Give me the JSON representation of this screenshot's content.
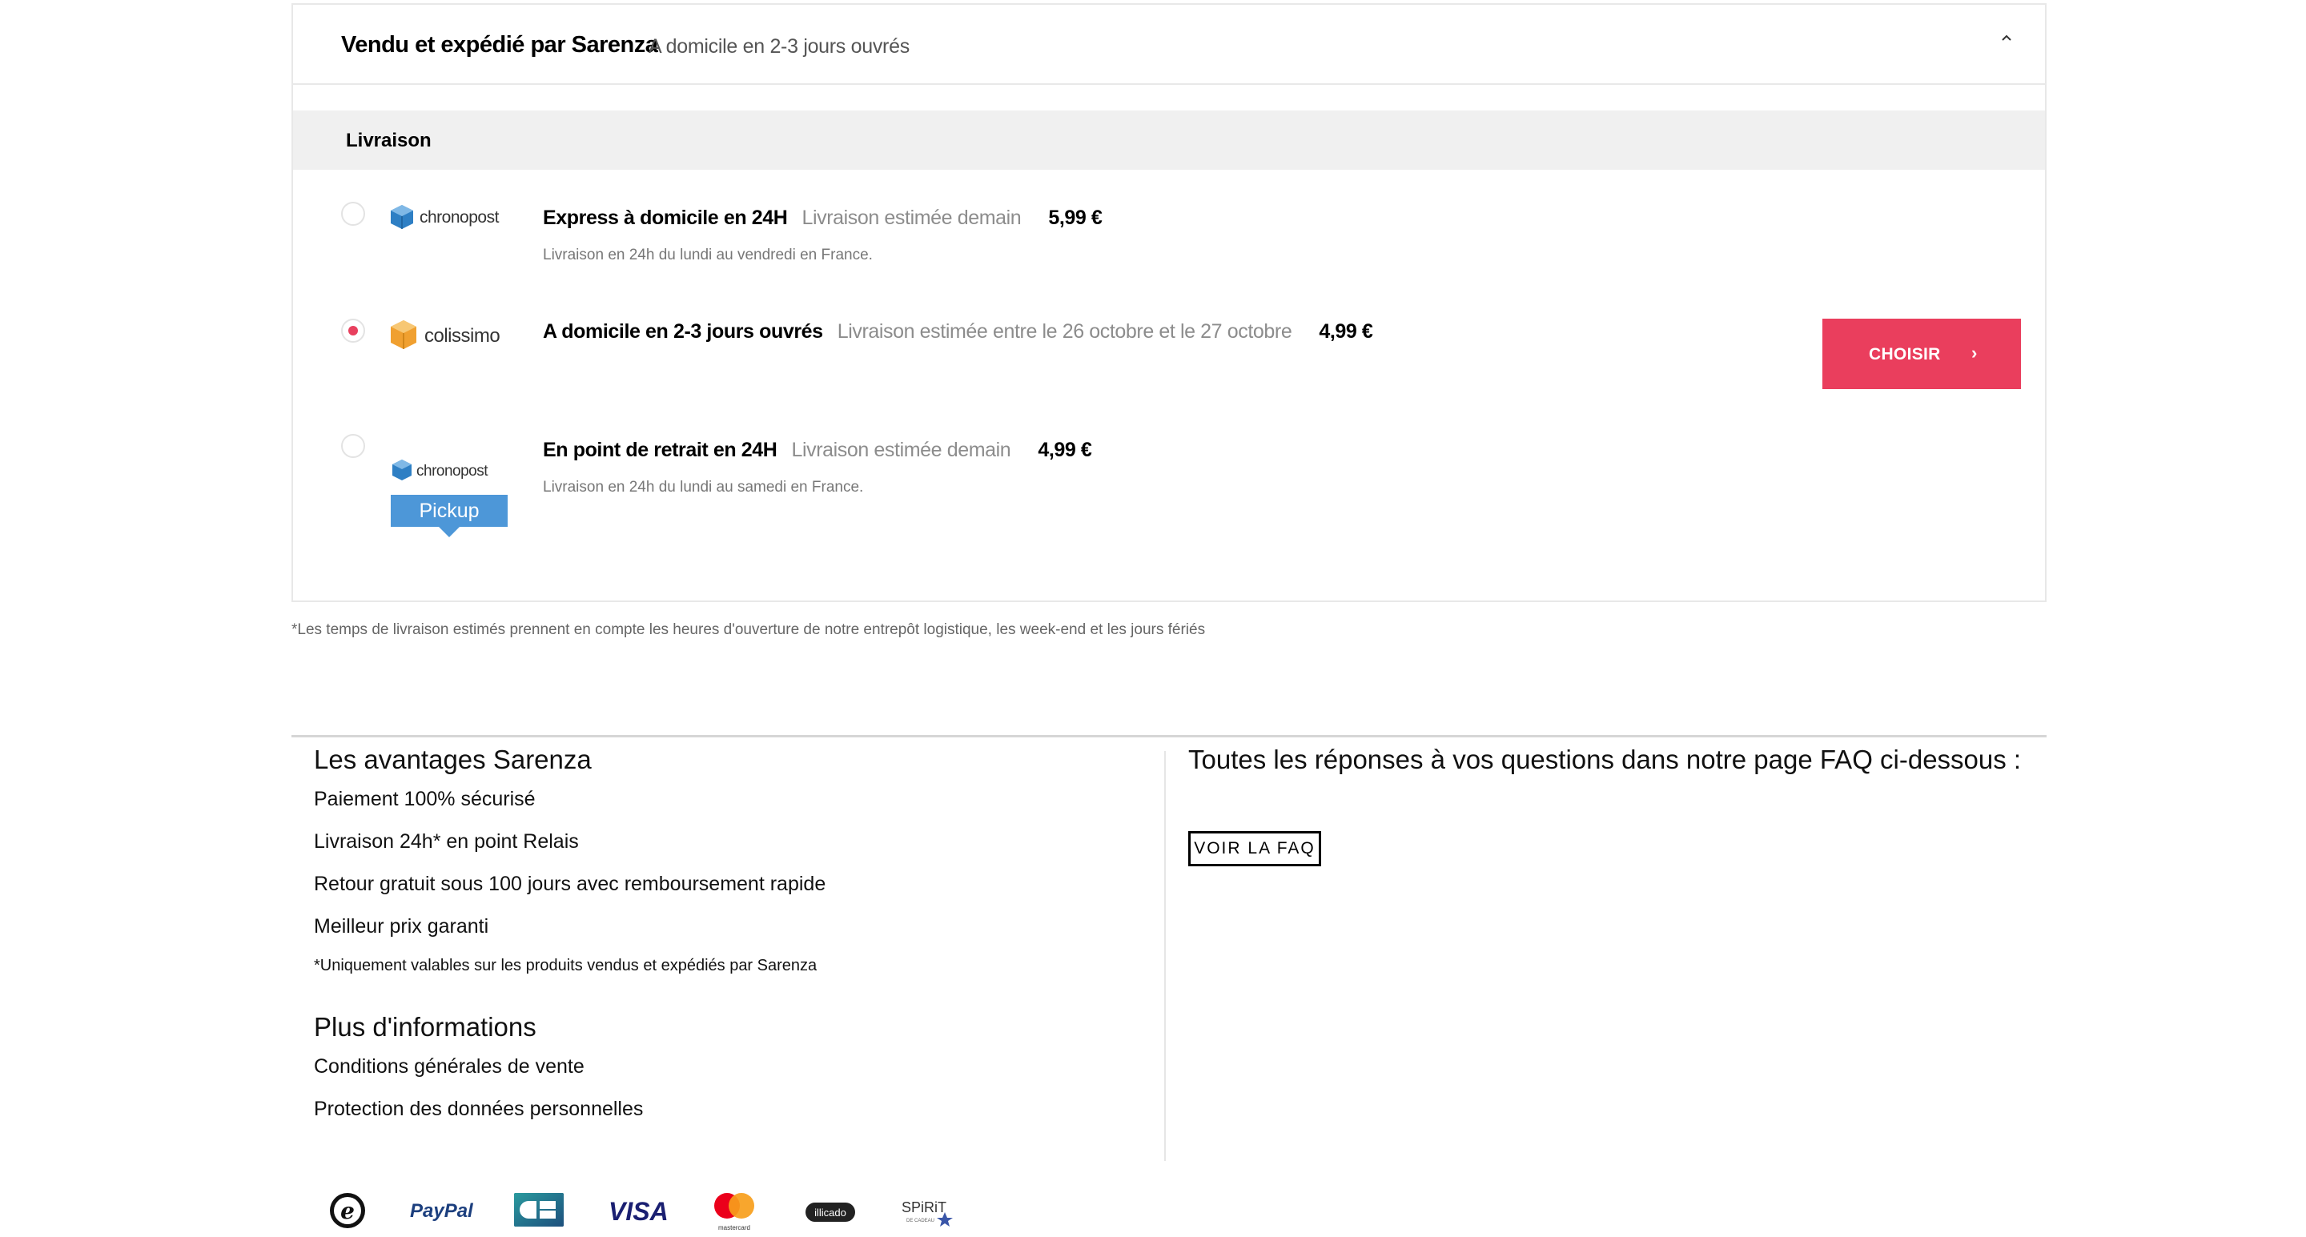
{
  "shipping": {
    "seller_title": "Vendu et expédié par Sarenza",
    "seller_subtitle": "A domicile en 2-3 jours ouvrés",
    "section_label": "Livraison",
    "options": [
      {
        "carrier": "chronopost",
        "title": "Express à domicile en 24H",
        "estimate": "Livraison estimée demain",
        "price": "5,99 €",
        "note": "Livraison en 24h du lundi au vendredi en France.",
        "selected": false
      },
      {
        "carrier": "colissimo",
        "title": "A domicile en 2-3 jours ouvrés",
        "estimate": "Livraison estimée entre le 26 octobre et le 27 octobre",
        "price": "4,99 €",
        "note": "",
        "selected": true
      },
      {
        "carrier": "chronopost",
        "carrier_badge": "Pickup",
        "title": "En point de retrait en 24H",
        "estimate": "Livraison estimée demain",
        "price": "4,99 €",
        "note": "Livraison en 24h du lundi au samedi en France.",
        "selected": false
      }
    ],
    "choose_label": "CHOISIR",
    "choose_arrow": "›",
    "disclaimer": "*Les temps de livraison estimés prennent en compte les heures d'ouverture de notre entrepôt logistique, les week-end et les jours fériés"
  },
  "footer": {
    "advantages_title": "Les avantages Sarenza",
    "advantages": [
      "Paiement 100% sécurisé",
      "Livraison 24h* en point Relais",
      "Retour gratuit sous 100 jours avec remboursement rapide",
      "Meilleur prix garanti"
    ],
    "advantages_note": "*Uniquement valables sur les produits vendus et expédiés par Sarenza",
    "info_title": "Plus d'informations",
    "info_links": [
      "Conditions générales de vente",
      "Protection des données personnelles"
    ],
    "faq_text": "Toutes les réponses à vos questions dans notre page FAQ ci-dessous :",
    "faq_button": "VOIR LA FAQ",
    "payment_icons": [
      "e-carte-icon",
      "paypal-icon",
      "cb-icon",
      "visa-icon",
      "mastercard-icon",
      "illicado-icon",
      "spirit-icon"
    ],
    "payment_text": {
      "paypal": "PayPal",
      "visa": "VISA",
      "mastercard": "mastercard",
      "illicado": "illicado",
      "spirit": "SPiRiT",
      "spirit_sub": "DE CADEAU",
      "e": "e"
    }
  },
  "colors": {
    "accent": "#ea3e5d",
    "chronopost_blue": "#2e7fc4",
    "colissimo_orange": "#f0a030",
    "pickup_blue": "#4d97d8"
  }
}
